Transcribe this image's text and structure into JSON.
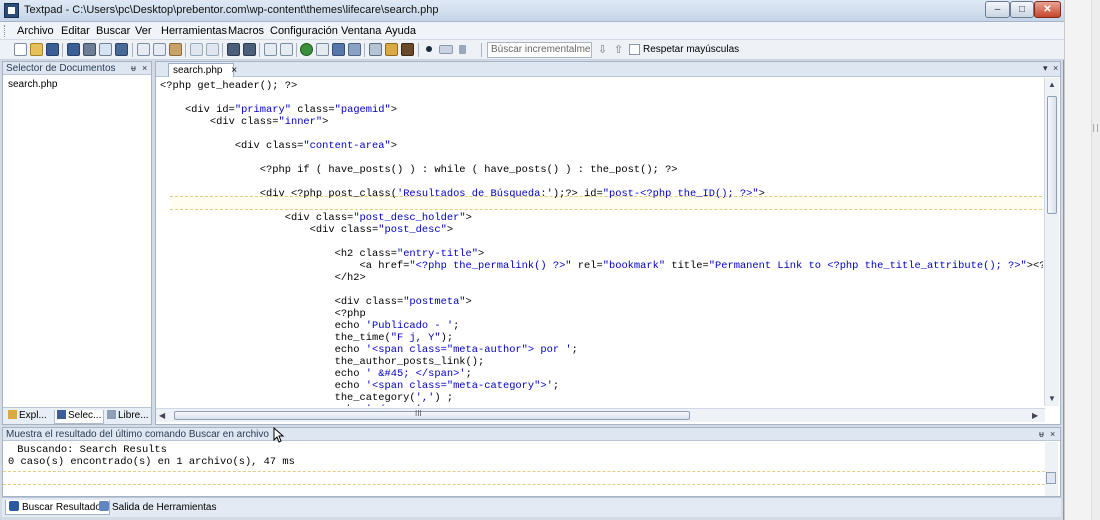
{
  "window": {
    "title": "Textpad - C:\\Users\\pc\\Desktop\\prebentor.com\\wp-content\\themes\\lifecare\\search.php",
    "controls": {
      "minimize": "‒",
      "maximize": "□",
      "close": "✕"
    }
  },
  "menu": [
    "Archivo",
    "Editar",
    "Buscar",
    "Ver",
    "Herramientas",
    "Macros",
    "Configuración",
    "Ventana",
    "Ayuda"
  ],
  "toolbar": {
    "search_placeholder": "Búscar incrementalmente",
    "down_arrow": "⇩",
    "up_arrow": "⇧",
    "match_case_label": "Respetar mayúsculas",
    "match_case_checked": false,
    "icons": [
      "new-file-icon",
      "open-icon",
      "save-icon",
      "save-all-icon",
      "print-icon",
      "print-preview-icon",
      "properties-icon",
      "cut-icon",
      "copy-icon",
      "paste-icon",
      "undo-icon",
      "redo-icon",
      "indent-icon",
      "outdent-icon",
      "wrap-icon",
      "paragraph-icon",
      "browser-icon",
      "spellcheck-icon",
      "sort-icon",
      "compare-icon",
      "find-icon",
      "replace-icon",
      "binoculars-icon",
      "record-macro-icon",
      "play-macro-icon",
      "run-icon"
    ]
  },
  "doc_selector": {
    "title": "Selector de Documentos",
    "pin": "ᵾ",
    "close": "×",
    "items": [
      "search.php"
    ],
    "tabs": [
      "Expl...",
      "Selec...",
      "Libre..."
    ]
  },
  "editor": {
    "tab_label": "search.php",
    "tab_close": "×",
    "strip_menu": "▾",
    "strip_close": "×",
    "scroll_grip": "III",
    "lines": [
      "<?php get_header(); ?>",
      "",
      "    <div id=\"primary\" class=\"pagemid\">",
      "        <div class=\"inner\">",
      "",
      "            <div class=\"content-area\">",
      "",
      "                <?php if ( have_posts() ) : while ( have_posts() ) : the_post(); ?>",
      "",
      "                <div <?php post_class('Resultados de Búsqueda:');?> id=\"post-<?php the_ID(); ?>\">",
      "",
      "                    <div class=\"post_desc_holder\">",
      "                        <div class=\"post_desc\">",
      "",
      "                            <h2 class=\"entry-title\">",
      "                                <a href=\"<?php the_permalink() ?>\" rel=\"bookmark\" title=\"Permanent Link to <?php the_title_attribute(); ?>\"><?php t",
      "                            </h2>",
      "",
      "                            <div class=\"postmeta\">",
      "                            <?php",
      "                            echo 'Publicado - ';",
      "                            the_time(\"F j, Y\");",
      "                            echo '<span class=\"meta-author\"> por ';",
      "                            the_author_posts_link();",
      "                            echo ' &#45; </span>';",
      "                            echo '<span class=\"meta-category\">';",
      "                            the_category(',') ;",
      "                            echo '</span>';"
    ]
  },
  "results": {
    "title": "Muestra el resultado del último comando Buscar en archivo",
    "pin": "ᵾ",
    "close": "×",
    "lines": [
      " Buscando: Search Results",
      "0 caso(s) encontrado(s) en 1 archivo(s), 47 ms"
    ]
  },
  "bottom_tabs": [
    "Buscar Resultados",
    "Salida de Herramientas"
  ]
}
